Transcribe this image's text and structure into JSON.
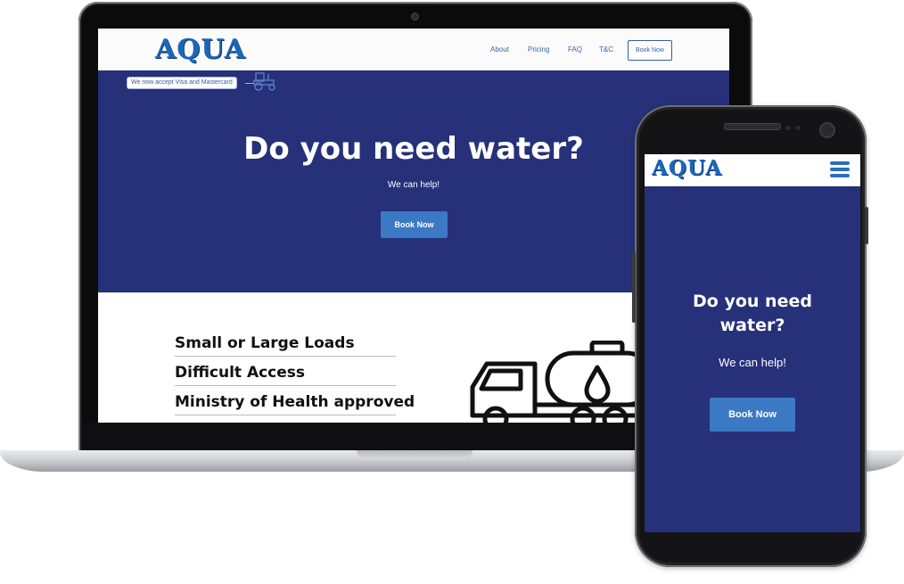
{
  "brand": {
    "logo_text": "AQUA",
    "primary_color": "#26317a",
    "accent_color": "#3c79c4",
    "logo_color": "#1c67b9"
  },
  "nav": {
    "about": "About",
    "pricing": "Pricing",
    "faq": "FAQ",
    "tc": "T&C",
    "book": "Book Now"
  },
  "banner": {
    "text": "We now accept Visa and Mastercard",
    "icon": "tractor-icon"
  },
  "hero": {
    "title": "Do you need water?",
    "subtitle": "We can help!",
    "button": "Book Now"
  },
  "features": [
    "Small or Large Loads",
    "Difficult Access",
    "Ministry of Health approved"
  ],
  "features_icon": "water-tanker-truck-icon",
  "mobile": {
    "logo_text": "AQUA",
    "menu_icon": "hamburger-menu-icon",
    "hero_title_line1": "Do you need",
    "hero_title_line2": "water?",
    "hero_subtitle": "We can help!",
    "hero_button": "Book Now"
  }
}
